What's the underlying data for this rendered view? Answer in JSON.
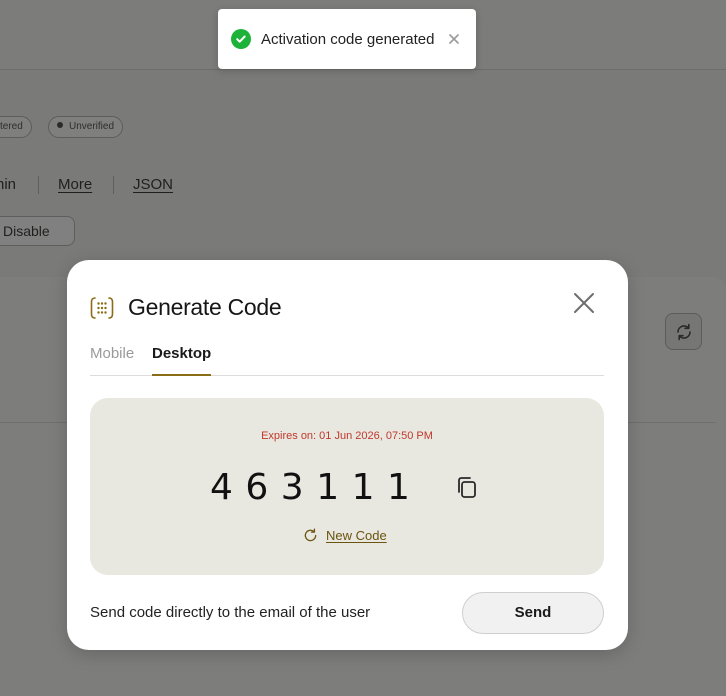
{
  "background": {
    "badges": [
      "stered",
      "Unverified"
    ],
    "links": [
      "nin",
      "More",
      "JSON"
    ],
    "disable_button": "Disable",
    "refresh_icon": "refresh-icon"
  },
  "toast": {
    "message": "Activation code generated",
    "status_color": "#1db33b",
    "close_icon": "close-icon"
  },
  "modal": {
    "title": "Generate Code",
    "title_icon": "keypad-icon",
    "tabs": [
      {
        "label": "Mobile",
        "active": false
      },
      {
        "label": "Desktop",
        "active": true
      }
    ],
    "expires_text": "Expires on: 01 Jun 2026, 07:50 PM",
    "code": "463111",
    "copy_icon": "copy-icon",
    "new_code_label": "New Code",
    "send_description": "Send code directly to the email of the user",
    "send_button": "Send",
    "accent_color": "#8a6d16"
  }
}
